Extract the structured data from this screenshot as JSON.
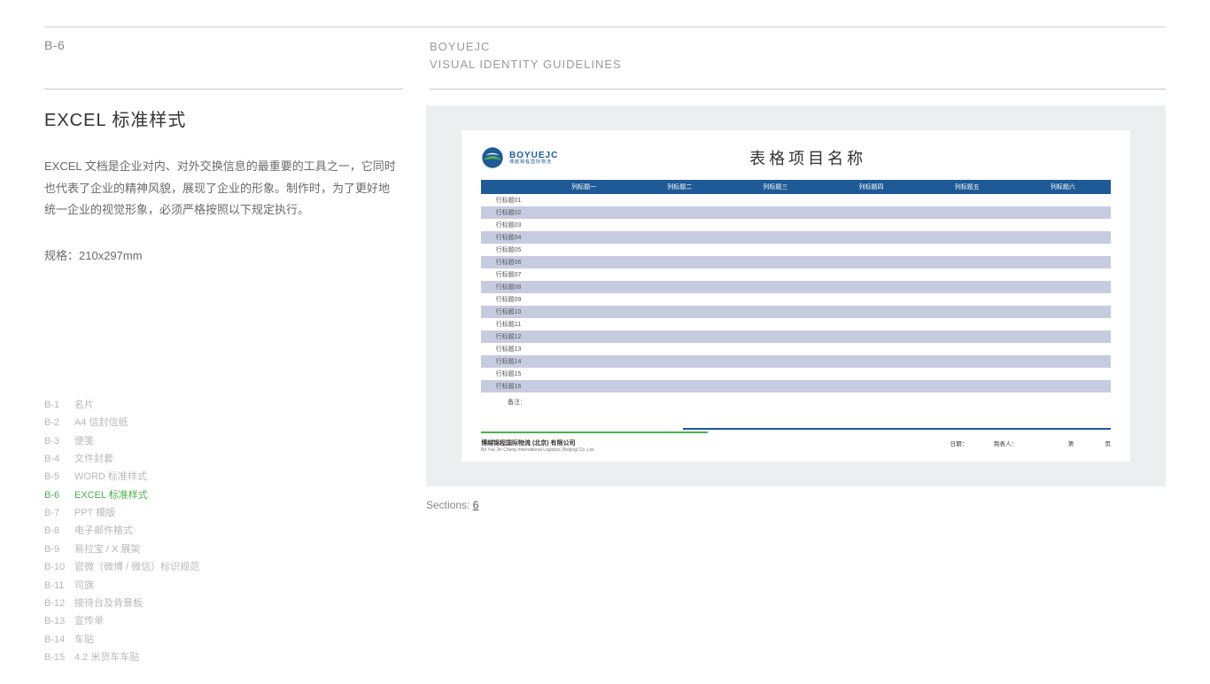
{
  "header": {
    "page_code": "B-6",
    "brand": "BOYUEJC",
    "subtitle": "VISUAL IDENTITY GUIDELINES"
  },
  "section": {
    "title": "EXCEL 标准样式",
    "body": "EXCEL 文档是企业对内、对外交换信息的最重要的工具之一，它同时也代表了企业的精神风貌，展现了企业的形象。制作时，为了更好地统一企业的视觉形象，必须严格按照以下规定执行。",
    "spec": "规格：210x297mm"
  },
  "nav": {
    "items": [
      {
        "code": "B-1",
        "label": "名片",
        "active": false
      },
      {
        "code": "B-2",
        "label": "A4 信封信纸",
        "active": false
      },
      {
        "code": "B-3",
        "label": "便笺",
        "active": false
      },
      {
        "code": "B-4",
        "label": "文件封套",
        "active": false
      },
      {
        "code": "B-5",
        "label": "WORD 标准样式",
        "active": false
      },
      {
        "code": "B-6",
        "label": "EXCEL 标准样式",
        "active": true
      },
      {
        "code": "B-7",
        "label": "PPT 模版",
        "active": false
      },
      {
        "code": "B-8",
        "label": "电子邮件格式",
        "active": false
      },
      {
        "code": "B-9",
        "label": "易拉宝 / X 展架",
        "active": false
      },
      {
        "code": "B-10",
        "label": "官微（微博 / 微信）标识规范",
        "active": false
      },
      {
        "code": "B-11",
        "label": "司旗",
        "active": false
      },
      {
        "code": "B-12",
        "label": "接待台及背景板",
        "active": false
      },
      {
        "code": "B-13",
        "label": "宣传单",
        "active": false
      },
      {
        "code": "B-14",
        "label": "车贴",
        "active": false
      },
      {
        "code": "B-15",
        "label": "4.2 米货车车贴",
        "active": false
      }
    ]
  },
  "preview": {
    "logo_text_top": "BOYUEJC",
    "logo_text_bottom": "博越锦程国际物流",
    "sheet_title": "表格项目名称",
    "columns": [
      "列标题一",
      "列标题二",
      "列标题三",
      "列标题四",
      "列标题五",
      "列标题六"
    ],
    "rows": [
      "行标题01",
      "行标题02",
      "行标题03",
      "行标题04",
      "行标题05",
      "行标题06",
      "行标题07",
      "行标题08",
      "行标题09",
      "行标题10",
      "行标题11",
      "行标题12",
      "行标题13",
      "行标题14",
      "行标题15",
      "行标题16"
    ],
    "note_label": "备注：",
    "footer": {
      "company_cn": "博越锦程国际物流 (北京) 有限公司",
      "company_en": "Bo Yue Jin Cheng International Logistics (Beijing) Co.,Ltd.",
      "date_label": "日期：",
      "made_by_label": "制表人：",
      "page_label_left": "第",
      "page_label_right": "页"
    }
  },
  "footer": {
    "sections_label": "Sections:",
    "sections_value": "6"
  },
  "colors": {
    "brand_blue": "#1e5a96",
    "brand_green": "#4caf50",
    "row_alt": "#c7cbe0"
  }
}
